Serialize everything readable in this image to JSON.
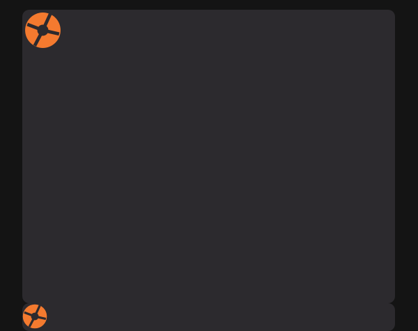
{
  "theme": {
    "page_background": "#141414",
    "card_background": "#2c2a2e",
    "accent": "#f47a2f",
    "logo_cutout": "#2c2a2e"
  },
  "feed": {
    "cards": [
      {
        "logo_icon": "orange-segmented-circle-logo-icon",
        "content": ""
      },
      {
        "logo_icon": "orange-segmented-circle-logo-icon",
        "content": ""
      }
    ]
  }
}
